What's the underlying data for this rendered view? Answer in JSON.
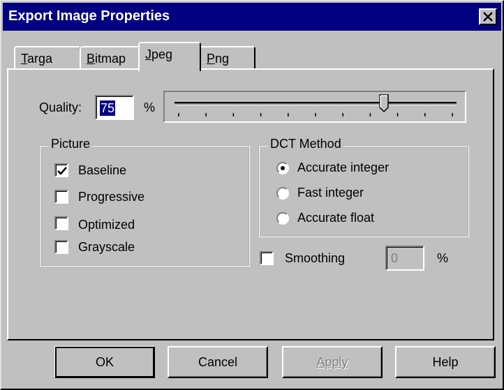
{
  "window": {
    "title": "Export Image Properties"
  },
  "tabs": [
    {
      "label": "Targa",
      "mnemonic": "T",
      "rest": "arga"
    },
    {
      "label": "Bitmap",
      "mnemonic": "B",
      "rest": "itmap"
    },
    {
      "label": "Jpeg",
      "mnemonic": "J",
      "rest": "peg",
      "active": true
    },
    {
      "label": "Png",
      "mnemonic": "P",
      "rest": "ng"
    }
  ],
  "quality": {
    "label": "Quality:",
    "value": "75",
    "unit": "%",
    "slider_value": 75,
    "slider_min": 0,
    "slider_max": 100
  },
  "picture": {
    "title": "Picture",
    "options": [
      {
        "label": "Baseline",
        "checked": true
      },
      {
        "label": "Progressive",
        "checked": false
      },
      {
        "label": "Optimized",
        "checked": false
      },
      {
        "label": "Grayscale",
        "checked": false
      }
    ]
  },
  "dct": {
    "title": "DCT Method",
    "options": [
      {
        "label": "Accurate integer",
        "selected": true
      },
      {
        "label": "Fast integer",
        "selected": false
      },
      {
        "label": "Accurate float",
        "selected": false
      }
    ]
  },
  "smoothing": {
    "label": "Smoothing",
    "checked": false,
    "value": "0",
    "unit": "%"
  },
  "buttons": {
    "ok": "OK",
    "cancel": "Cancel",
    "apply": "Apply",
    "help": "Help"
  },
  "colors": {
    "titlebar": "#000080",
    "face": "#c0c0c0",
    "highlight": "#000080"
  }
}
